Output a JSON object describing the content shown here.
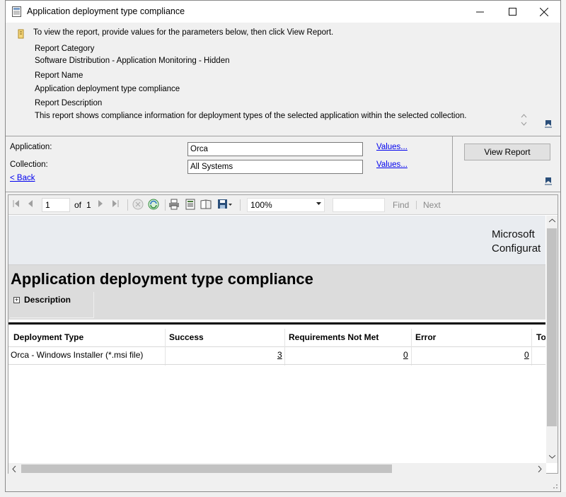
{
  "window": {
    "title": "Application deployment type compliance",
    "minimize": "—",
    "maximize": "☐",
    "close": "✕"
  },
  "info": {
    "instructions": "To view the report, provide values for the parameters below, then click View Report.",
    "category_label": "Report Category",
    "category_value": "Software Distribution - Application Monitoring - Hidden",
    "name_label": "Report Name",
    "name_value": "Application deployment type compliance",
    "description_label": "Report Description",
    "description_value": "This report shows compliance information for deployment types of the selected application within the selected collection."
  },
  "params": {
    "application_label": "Application:",
    "application_value": "Orca",
    "collection_label": "Collection:",
    "collection_value": "All Systems",
    "values_link": "Values...",
    "back_link": "< Back",
    "view_report_button": "View Report"
  },
  "toolbar": {
    "page": "1",
    "of_label": "of",
    "total_pages": "1",
    "zoom": "100%",
    "find": "Find",
    "next": "Next"
  },
  "report": {
    "brand_line1": "Microsoft",
    "brand_line2": "Configurat",
    "title": "Application deployment type compliance",
    "description_toggle": "Description",
    "columns": [
      "Deployment Type",
      "Success",
      "Requirements Not Met",
      "Error",
      "To"
    ],
    "rows": [
      {
        "deployment_type": "Orca - Windows Installer (*.msi file)",
        "success": "3",
        "requirements_not_met": "0",
        "error": "0"
      }
    ]
  },
  "colors": {
    "link": "#0000ee",
    "header_band": "#e9ecf0",
    "title_band": "#dcdcdc"
  }
}
